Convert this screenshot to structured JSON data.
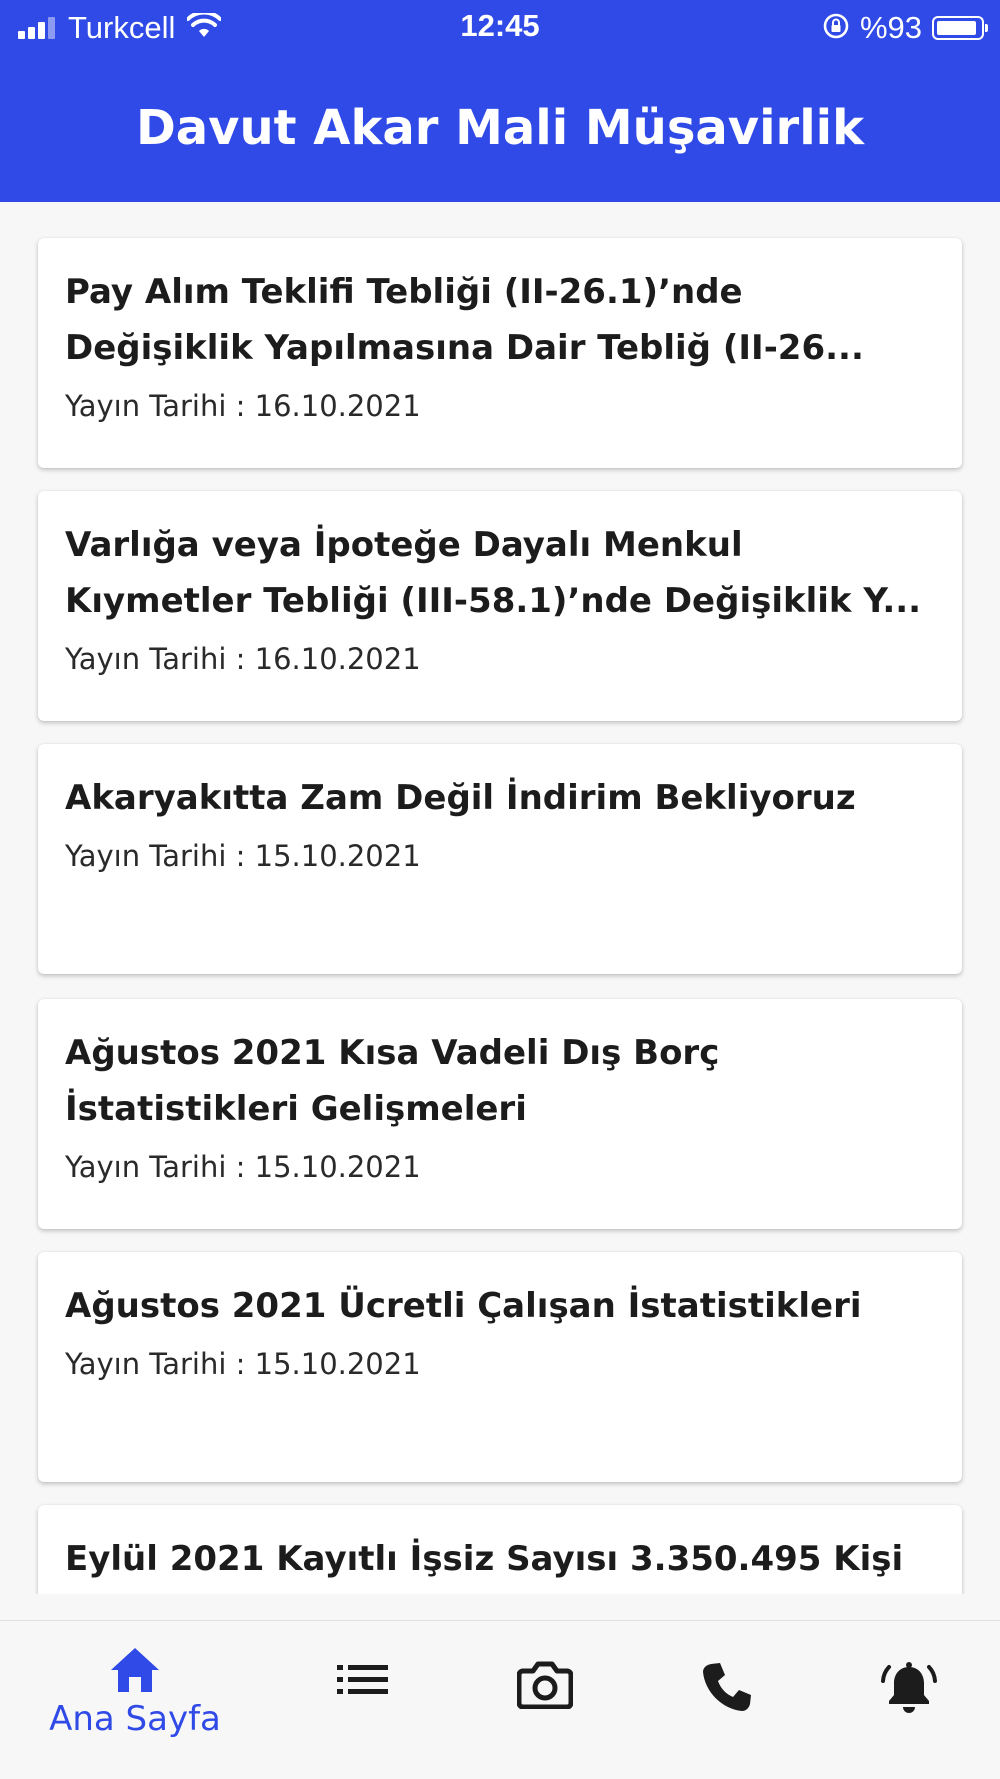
{
  "status_bar": {
    "carrier": "Turkcell",
    "time": "12:45",
    "battery_percent": "%93",
    "battery_level": 0.93,
    "icons": [
      "signal-icon",
      "wifi-icon",
      "rotation-lock-icon",
      "battery-icon"
    ]
  },
  "header": {
    "title": "Davut Akar Mali Müşavirlik",
    "color": "#2f4ae6"
  },
  "news": [
    {
      "title": "Pay Alım Teklifi Tebliği (II-26.1)’nde Değişiklik Yapılmasına Dair Tebliğ (II-26...",
      "date": "Yayın Tarihi : 16.10.2021"
    },
    {
      "title": "Varlığa veya İpoteğe Dayalı Menkul Kıymetler Tebliği (III-58.1)’nde Değişiklik Y...",
      "date": "Yayın Tarihi : 16.10.2021"
    },
    {
      "title": "Akaryakıtta Zam Değil İndirim Bekliyoruz",
      "date": "Yayın Tarihi : 15.10.2021"
    },
    {
      "title": "Ağustos 2021 Kısa Vadeli Dış Borç İstatistikleri Gelişmeleri",
      "date": "Yayın Tarihi : 15.10.2021"
    },
    {
      "title": "Ağustos 2021 Ücretli Çalışan İstatistikleri",
      "date": "Yayın Tarihi : 15.10.2021"
    },
    {
      "title": "Eylül 2021 Kayıtlı İşsiz Sayısı 3.350.495 Kişi",
      "date": ""
    }
  ],
  "bottom_nav": {
    "active_color": "#2f4ae6",
    "items": [
      {
        "icon": "home-icon",
        "label": "Ana Sayfa",
        "active": true
      },
      {
        "icon": "list-icon",
        "label": "",
        "active": false
      },
      {
        "icon": "camera-icon",
        "label": "",
        "active": false
      },
      {
        "icon": "phone-icon",
        "label": "",
        "active": false
      },
      {
        "icon": "alarm-bell-icon",
        "label": "",
        "active": false
      }
    ]
  }
}
